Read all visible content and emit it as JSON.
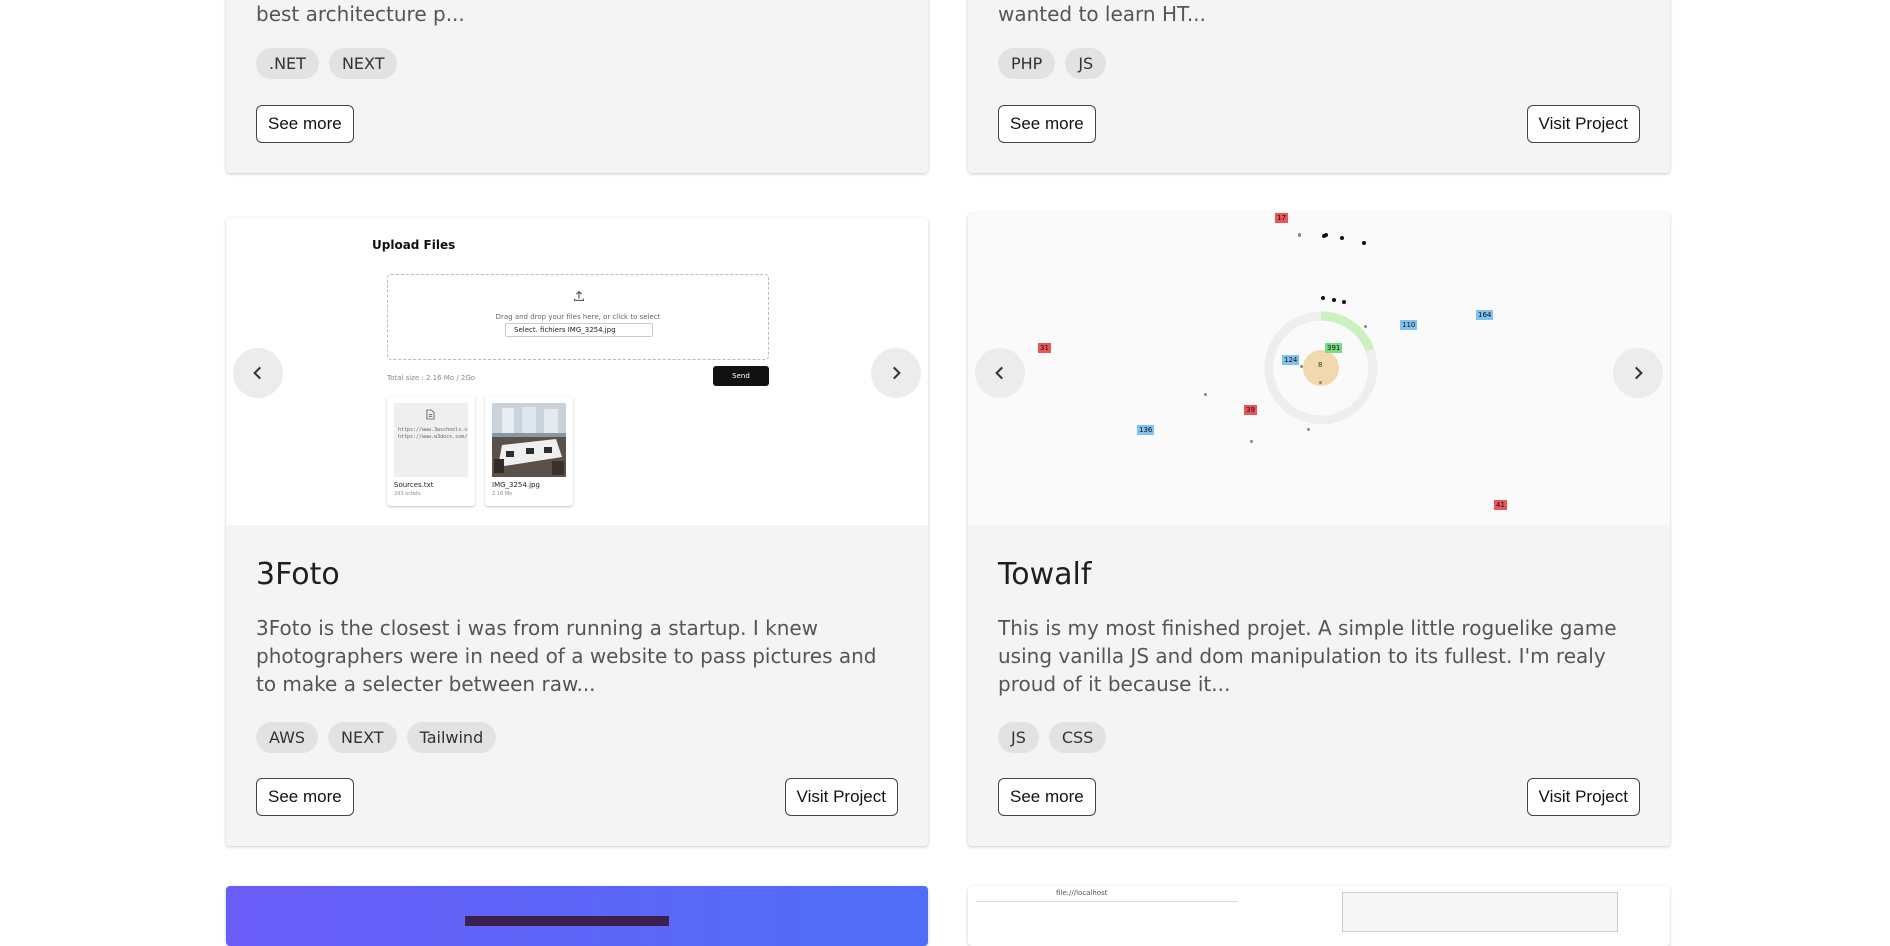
{
  "cards": [
    {
      "id": "card-top-left",
      "description": "best architecture p...",
      "tags": [
        ".NET",
        "NEXT"
      ],
      "see_more": "See more"
    },
    {
      "id": "card-top-right",
      "description": "wanted to learn HT...",
      "tags": [
        "PHP",
        "JS"
      ],
      "see_more": "See more",
      "visit": "Visit Project"
    },
    {
      "id": "card-3foto",
      "title": "3Foto",
      "description": "3Foto is the closest i was from running a startup. I knew photographers were in need of a website to pass pictures and to make a selecter between raw...",
      "tags": [
        "AWS",
        "NEXT",
        "Tailwind"
      ],
      "see_more": "See more",
      "visit": "Visit Project",
      "preview": {
        "title": "Upload Files",
        "drop_text": "Drag and drop your files here, or click to select",
        "file_input": "Select. fichiers   IMG_3254.jpg",
        "total": "Total size : 2.16 Mo / 2Go",
        "send": "Send",
        "files": [
          {
            "name": "Sources.txt",
            "size": "293 octets",
            "content": "https://www.3wschools.com/javascript/js_... https://www.w3docs.com/snippets/..."
          },
          {
            "name": "IMG_3254.jpg",
            "size": "2.16 Mo"
          }
        ]
      }
    },
    {
      "id": "card-towalf",
      "title": "Towalf",
      "description": "This is my most finished projet. A simple little roguelike game using vanilla JS and dom manipulation to its fullest. I'm realy proud of it because it...",
      "tags": [
        "JS",
        "CSS"
      ],
      "see_more": "See more",
      "visit": "Visit Project",
      "preview": {
        "labels": [
          {
            "text": "17",
            "color": "red"
          },
          {
            "text": "31",
            "color": "red"
          },
          {
            "text": "124",
            "color": "blue"
          },
          {
            "text": "391",
            "color": "green"
          },
          {
            "text": "110",
            "color": "blue"
          },
          {
            "text": "164",
            "color": "blue"
          },
          {
            "text": "39",
            "color": "red"
          },
          {
            "text": "136",
            "color": "blue"
          },
          {
            "text": "41",
            "color": "red"
          }
        ],
        "player_value": "8",
        "browser_url": "file:///localhost"
      }
    }
  ],
  "colors": {
    "card_bg": "#f4f4f4",
    "tag_bg": "#e2e2e2",
    "gradient_start": "#6a5cf7",
    "gradient_end": "#4f6ef7"
  },
  "icons": {
    "prev": "chevron-left-icon",
    "next": "chevron-right-icon",
    "upload": "upload-icon",
    "file": "file-icon"
  }
}
